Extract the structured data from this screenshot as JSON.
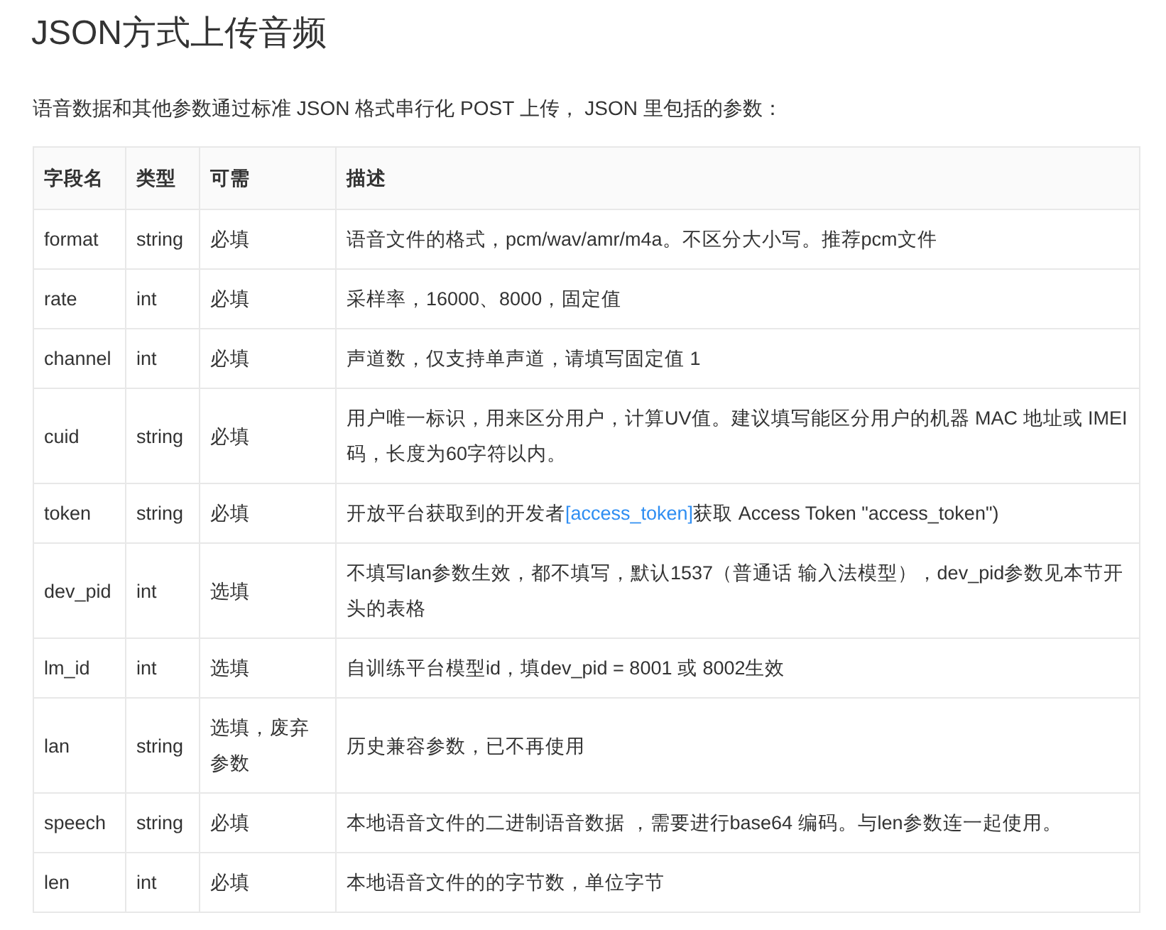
{
  "title": "JSON方式上传音频",
  "intro": "语音数据和其他参数通过标准 JSON 格式串行化 POST 上传， JSON 里包括的参数：",
  "table": {
    "columns": [
      "字段名",
      "类型",
      "可需",
      "描述"
    ],
    "rows": [
      {
        "field": "format",
        "type": "string",
        "required": "必填",
        "description": "语音文件的格式，pcm/wav/amr/m4a。不区分大小写。推荐pcm文件"
      },
      {
        "field": "rate",
        "type": "int",
        "required": "必填",
        "description": "采样率，16000、8000，固定值"
      },
      {
        "field": "channel",
        "type": "int",
        "required": "必填",
        "description": "声道数，仅支持单声道，请填写固定值 1"
      },
      {
        "field": "cuid",
        "type": "string",
        "required": "必填",
        "description": "用户唯一标识，用来区分用户，计算UV值。建议填写能区分用户的机器 MAC 地址或 IMEI 码，长度为60字符以内。"
      },
      {
        "field": "token",
        "type": "string",
        "required": "必填",
        "description": "开放平台获取到的开发者",
        "link": "[access_token]",
        "description_after": "获取 Access Token \"access_token\")"
      },
      {
        "field": "dev_pid",
        "type": "int",
        "required": "选填",
        "description": "不填写lan参数生效，都不填写，默认1537（普通话 输入法模型），dev_pid参数见本节开头的表格"
      },
      {
        "field": "lm_id",
        "type": "int",
        "required": "选填",
        "description": "自训练平台模型id，填dev_pid = 8001 或 8002生效"
      },
      {
        "field": "lan",
        "type": "string",
        "required": "选填，废弃参数",
        "description": "历史兼容参数，已不再使用"
      },
      {
        "field": "speech",
        "type": "string",
        "required": "必填",
        "description": "本地语音文件的二进制语音数据 ，需要进行base64 编码。与len参数连一起使用。"
      },
      {
        "field": "len",
        "type": "int",
        "required": "必填",
        "description": "本地语音文件的的字节数，单位字节"
      }
    ]
  }
}
